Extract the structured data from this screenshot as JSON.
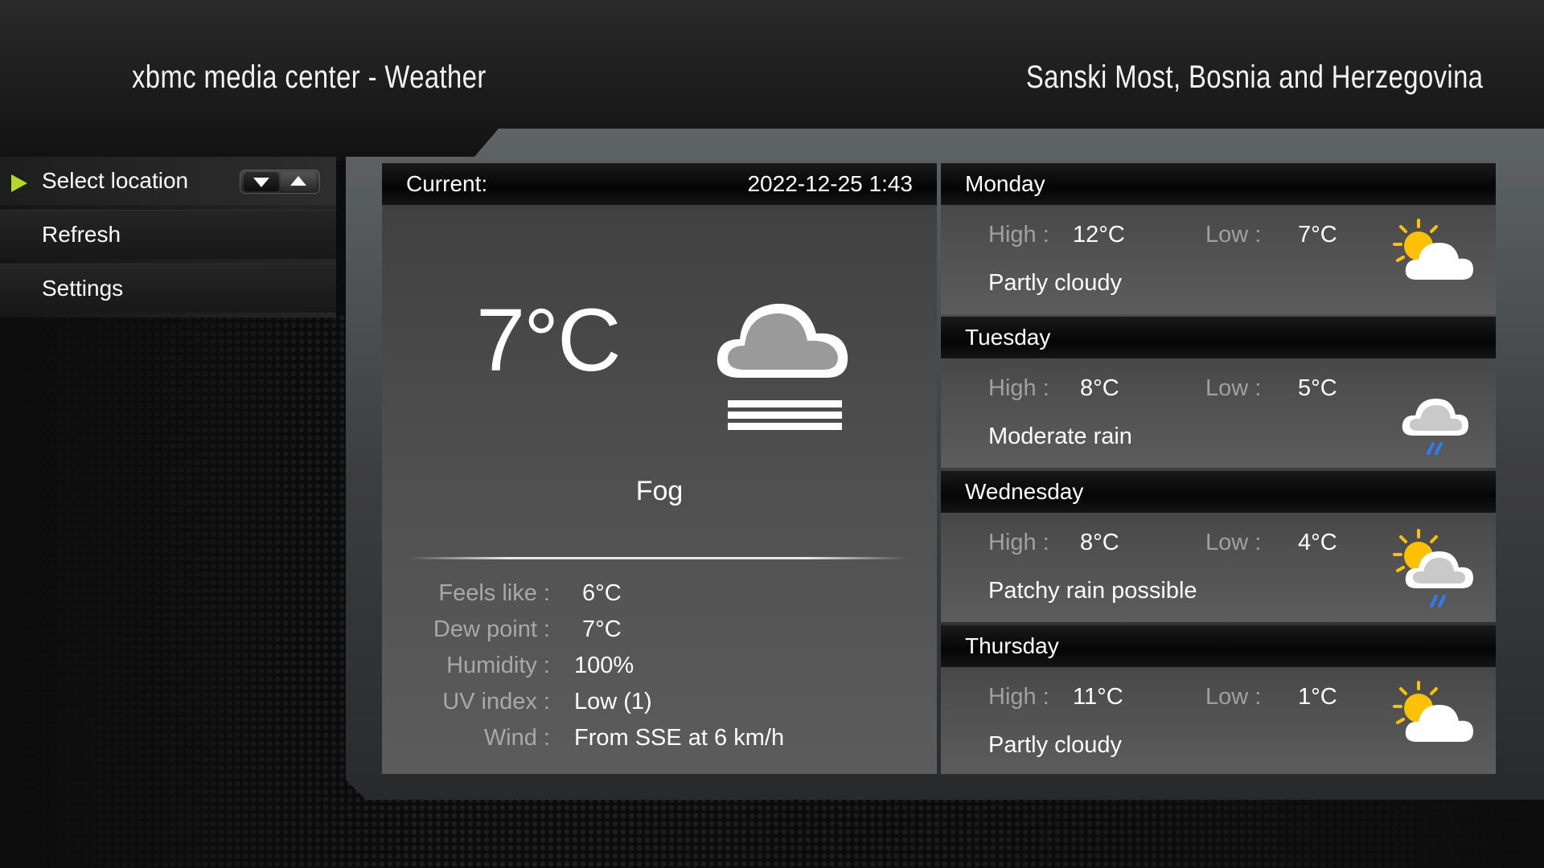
{
  "header": {
    "app_title": "xbmc media center - Weather",
    "location": "Sanski Most, Bosnia and Herzegovina"
  },
  "menu": {
    "items": [
      {
        "label": "Select location"
      },
      {
        "label": "Refresh"
      },
      {
        "label": "Settings"
      }
    ]
  },
  "current": {
    "label": "Current:",
    "datetime": "2022-12-25 1:43",
    "temperature": "7°C",
    "condition": "Fog",
    "icon": "fog-cloud-icon",
    "details": [
      {
        "label": "Feels like :",
        "value": "6°C"
      },
      {
        "label": "Dew point :",
        "value": "7°C"
      },
      {
        "label": "Humidity :",
        "value": "100%"
      },
      {
        "label": "UV index :",
        "value": "Low (1)"
      },
      {
        "label": "Wind :",
        "value": "From SSE at 6 km/h"
      }
    ]
  },
  "forecast_labels": {
    "high": "High :",
    "low": "Low :"
  },
  "forecast": [
    {
      "day": "Monday",
      "high": "12°C",
      "low": "7°C",
      "desc": "Partly cloudy",
      "icon": "partly-cloudy-icon"
    },
    {
      "day": "Tuesday",
      "high": "8°C",
      "low": "5°C",
      "desc": "Moderate rain",
      "icon": "rain-cloud-icon"
    },
    {
      "day": "Wednesday",
      "high": "8°C",
      "low": "4°C",
      "desc": "Patchy rain possible",
      "icon": "patchy-rain-icon"
    },
    {
      "day": "Thursday",
      "high": "11°C",
      "low": "1°C",
      "desc": "Partly cloudy",
      "icon": "partly-cloudy-icon"
    }
  ],
  "colors": {
    "accent": "#b6d62a",
    "rain": "#2f7bff",
    "sun": "#ffc107"
  }
}
